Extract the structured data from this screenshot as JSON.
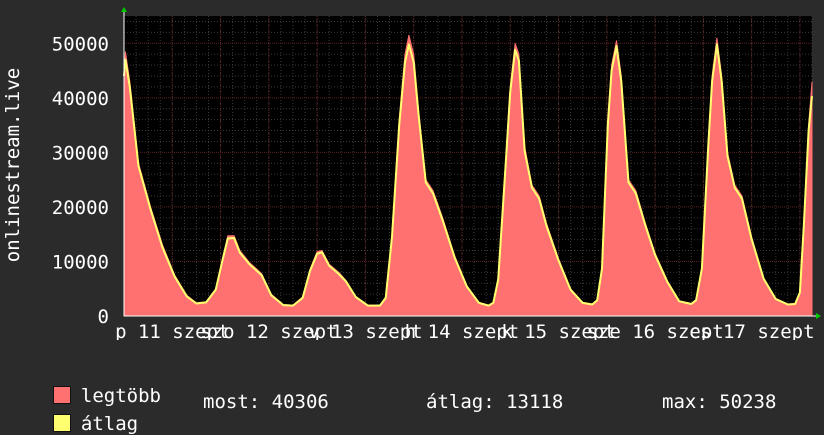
{
  "chart_data": {
    "type": "line",
    "ylabel": "onlinestream.live",
    "ylim": [
      0,
      55000
    ],
    "yticks": [
      0,
      10000,
      20000,
      30000,
      40000,
      50000
    ],
    "xlabels": [
      "p 11 szept",
      "szo 12 szept",
      "v 13 szept",
      "h 14 szept",
      "k 15 szept",
      "sze 16 szept",
      "cs 17 szept"
    ],
    "grid": true,
    "colors": {
      "background": "#000000",
      "grid": "#5a2020",
      "minor_grid": "#3a3a3a",
      "axis": "#ffffff",
      "max_fill": "#ff7070",
      "avg_line": "#ffff70"
    },
    "series": [
      {
        "name": "legtöbb",
        "color": "#ff7070",
        "points": [
          [
            0.0,
            44000
          ],
          [
            0.03,
            48500
          ],
          [
            0.12,
            43000
          ],
          [
            0.3,
            28000
          ],
          [
            0.55,
            20000
          ],
          [
            0.8,
            13000
          ],
          [
            1.05,
            7500
          ],
          [
            1.3,
            3800
          ],
          [
            1.5,
            2400
          ],
          [
            1.7,
            2600
          ],
          [
            1.9,
            5000
          ],
          [
            2.05,
            11000
          ],
          [
            2.15,
            14700
          ],
          [
            2.28,
            14700
          ],
          [
            2.4,
            12000
          ],
          [
            2.6,
            9800
          ],
          [
            2.85,
            7800
          ],
          [
            3.05,
            4000
          ],
          [
            3.3,
            2100
          ],
          [
            3.5,
            2000
          ],
          [
            3.7,
            3500
          ],
          [
            3.85,
            8500
          ],
          [
            4.0,
            11800
          ],
          [
            4.1,
            12000
          ],
          [
            4.25,
            9500
          ],
          [
            4.45,
            8000
          ],
          [
            4.6,
            6500
          ],
          [
            4.8,
            3600
          ],
          [
            5.05,
            2000
          ],
          [
            5.3,
            2000
          ],
          [
            5.42,
            3500
          ],
          [
            5.55,
            15000
          ],
          [
            5.7,
            36000
          ],
          [
            5.82,
            48000
          ],
          [
            5.9,
            51500
          ],
          [
            6.0,
            48000
          ],
          [
            6.1,
            38000
          ],
          [
            6.25,
            25000
          ],
          [
            6.4,
            23000
          ],
          [
            6.6,
            18000
          ],
          [
            6.85,
            11000
          ],
          [
            7.1,
            5600
          ],
          [
            7.35,
            2500
          ],
          [
            7.55,
            2000
          ],
          [
            7.65,
            2500
          ],
          [
            7.75,
            7000
          ],
          [
            7.9,
            28000
          ],
          [
            8.0,
            42000
          ],
          [
            8.1,
            50000
          ],
          [
            8.18,
            48000
          ],
          [
            8.3,
            31000
          ],
          [
            8.45,
            24000
          ],
          [
            8.6,
            22000
          ],
          [
            8.75,
            17000
          ],
          [
            9.0,
            10500
          ],
          [
            9.25,
            5000
          ],
          [
            9.5,
            2500
          ],
          [
            9.7,
            2200
          ],
          [
            9.8,
            3000
          ],
          [
            9.9,
            9000
          ],
          [
            10.02,
            36000
          ],
          [
            10.1,
            46000
          ],
          [
            10.2,
            50500
          ],
          [
            10.3,
            44000
          ],
          [
            10.45,
            25000
          ],
          [
            10.6,
            23000
          ],
          [
            10.8,
            17000
          ],
          [
            11.0,
            11500
          ],
          [
            11.25,
            6500
          ],
          [
            11.5,
            2800
          ],
          [
            11.75,
            2300
          ],
          [
            11.85,
            3000
          ],
          [
            11.97,
            9000
          ],
          [
            12.1,
            32000
          ],
          [
            12.18,
            44000
          ],
          [
            12.28,
            51000
          ],
          [
            12.38,
            44000
          ],
          [
            12.5,
            30000
          ],
          [
            12.65,
            24000
          ],
          [
            12.8,
            22000
          ],
          [
            13.0,
            14500
          ],
          [
            13.25,
            7000
          ],
          [
            13.5,
            3200
          ],
          [
            13.75,
            2200
          ],
          [
            13.9,
            2300
          ],
          [
            14.0,
            4500
          ],
          [
            14.08,
            17000
          ],
          [
            14.18,
            35000
          ],
          [
            14.25,
            43000
          ]
        ]
      },
      {
        "name": "átlag",
        "color": "#ffff70",
        "points": [
          [
            0.0,
            44000
          ],
          [
            0.03,
            47000
          ],
          [
            0.12,
            42000
          ],
          [
            0.3,
            27500
          ],
          [
            0.55,
            19500
          ],
          [
            0.8,
            12500
          ],
          [
            1.05,
            7200
          ],
          [
            1.3,
            3600
          ],
          [
            1.5,
            2300
          ],
          [
            1.7,
            2500
          ],
          [
            1.9,
            4800
          ],
          [
            2.05,
            10600
          ],
          [
            2.15,
            14200
          ],
          [
            2.28,
            14300
          ],
          [
            2.4,
            11600
          ],
          [
            2.6,
            9500
          ],
          [
            2.85,
            7500
          ],
          [
            3.05,
            3800
          ],
          [
            3.3,
            2000
          ],
          [
            3.5,
            1900
          ],
          [
            3.7,
            3300
          ],
          [
            3.85,
            8200
          ],
          [
            4.0,
            11400
          ],
          [
            4.1,
            11700
          ],
          [
            4.25,
            9200
          ],
          [
            4.45,
            7700
          ],
          [
            4.6,
            6300
          ],
          [
            4.8,
            3500
          ],
          [
            5.05,
            1900
          ],
          [
            5.3,
            1900
          ],
          [
            5.42,
            3300
          ],
          [
            5.55,
            14500
          ],
          [
            5.7,
            35000
          ],
          [
            5.82,
            46500
          ],
          [
            5.9,
            49800
          ],
          [
            6.0,
            46500
          ],
          [
            6.1,
            37000
          ],
          [
            6.25,
            24500
          ],
          [
            6.4,
            22500
          ],
          [
            6.6,
            17500
          ],
          [
            6.85,
            10700
          ],
          [
            7.1,
            5400
          ],
          [
            7.35,
            2400
          ],
          [
            7.55,
            1900
          ],
          [
            7.65,
            2400
          ],
          [
            7.75,
            6700
          ],
          [
            7.9,
            27000
          ],
          [
            8.0,
            41000
          ],
          [
            8.1,
            48800
          ],
          [
            8.18,
            46800
          ],
          [
            8.3,
            30200
          ],
          [
            8.45,
            23500
          ],
          [
            8.6,
            21500
          ],
          [
            8.75,
            16500
          ],
          [
            9.0,
            10200
          ],
          [
            9.25,
            4800
          ],
          [
            9.5,
            2400
          ],
          [
            9.7,
            2100
          ],
          [
            9.8,
            2900
          ],
          [
            9.9,
            8700
          ],
          [
            10.02,
            35000
          ],
          [
            10.1,
            45000
          ],
          [
            10.2,
            49500
          ],
          [
            10.3,
            43000
          ],
          [
            10.45,
            24500
          ],
          [
            10.6,
            22500
          ],
          [
            10.8,
            16600
          ],
          [
            11.0,
            11200
          ],
          [
            11.25,
            6300
          ],
          [
            11.5,
            2700
          ],
          [
            11.75,
            2200
          ],
          [
            11.85,
            2900
          ],
          [
            11.97,
            8700
          ],
          [
            12.1,
            31000
          ],
          [
            12.18,
            43000
          ],
          [
            12.28,
            49800
          ],
          [
            12.38,
            43000
          ],
          [
            12.5,
            29300
          ],
          [
            12.65,
            23500
          ],
          [
            12.8,
            21500
          ],
          [
            13.0,
            14100
          ],
          [
            13.25,
            6800
          ],
          [
            13.5,
            3100
          ],
          [
            13.75,
            2100
          ],
          [
            13.9,
            2200
          ],
          [
            14.0,
            4300
          ],
          [
            14.08,
            16500
          ],
          [
            14.18,
            34000
          ],
          [
            14.25,
            40306
          ]
        ]
      }
    ]
  },
  "legend": {
    "max_label": "legtöbb",
    "avg_label": "átlag"
  },
  "stats": {
    "current": "most: 40306",
    "average": "átlag: 13118",
    "max": "max: 50238"
  }
}
